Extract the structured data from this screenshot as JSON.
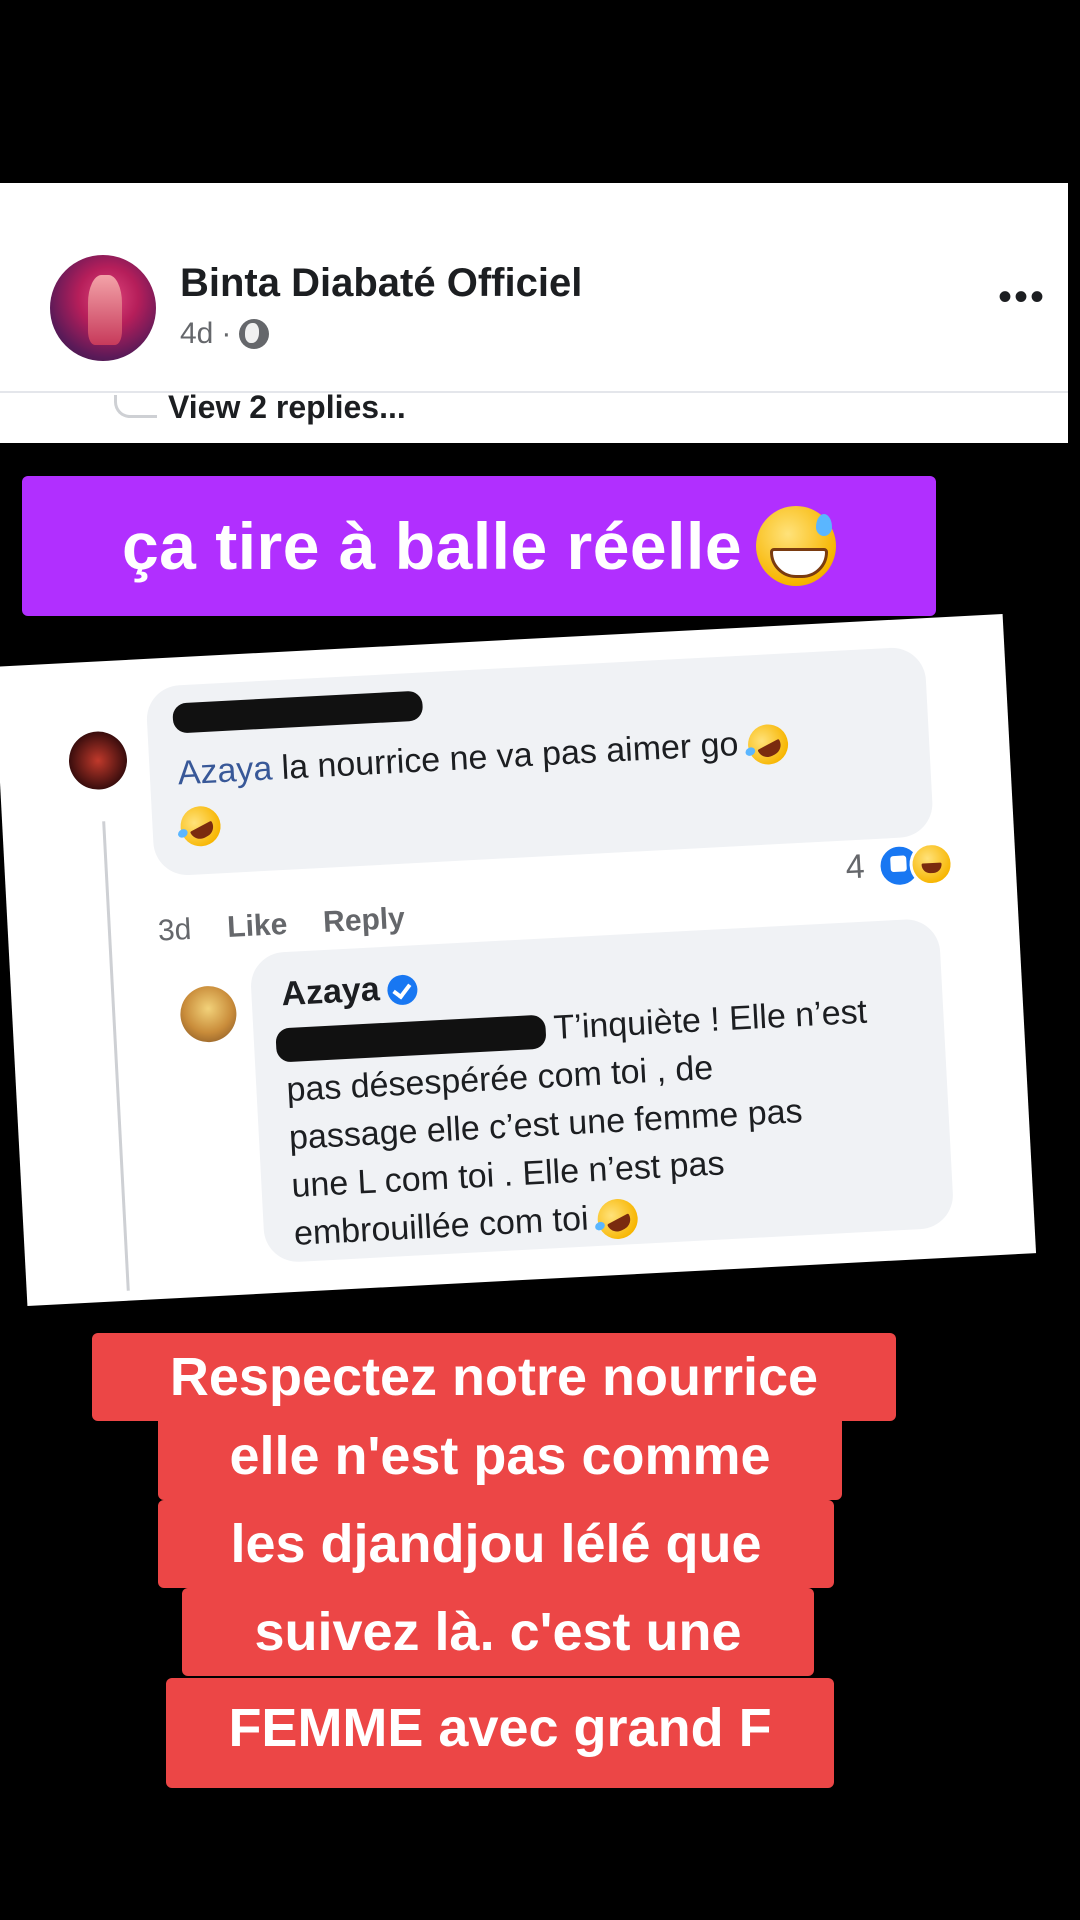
{
  "post": {
    "author": "Binta Diabaté Officiel",
    "time": "4d",
    "separator": "·",
    "view_replies": "View 2 replies..."
  },
  "banner": {
    "text": "ça tire à balle réelle",
    "emoji": "grinning-sweat-emoji",
    "color": "#b12fff"
  },
  "comment1": {
    "mention": "Azaya",
    "text": " la nourrice ne va pas aimer go",
    "reaction_count": "4",
    "time": "3d",
    "like_label": "Like",
    "reply_label": "Reply"
  },
  "comment2": {
    "author": "Azaya",
    "line1": "T’inquiète ! Elle n’est",
    "line2": "pas désespérée com toi , de",
    "line3": "passage elle c’est une femme pas",
    "line4": "une L com toi . Elle n’est pas",
    "line5": "embrouillée com toi"
  },
  "caption": {
    "line1": "Respectez notre nourrice",
    "line2": "elle n'est pas comme",
    "line3": "les djandjou lélé que",
    "line4": "suivez là. c'est une",
    "line5": "FEMME avec grand F",
    "color": "#ec4646"
  }
}
